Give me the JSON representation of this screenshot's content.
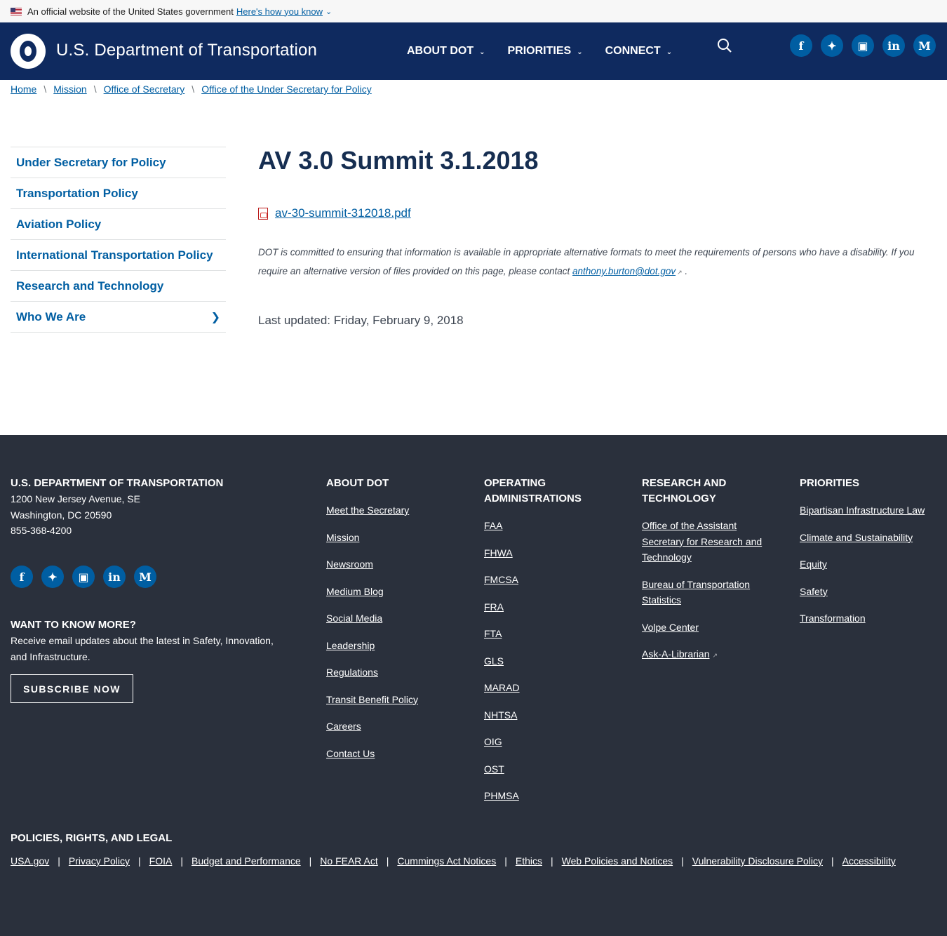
{
  "gov_banner": {
    "text": "An official website of the United States government",
    "how_link": "Here's how you know"
  },
  "header": {
    "site_title": "U.S. Department of Transportation",
    "nav": [
      {
        "label": "ABOUT DOT"
      },
      {
        "label": "PRIORITIES"
      },
      {
        "label": "CONNECT"
      }
    ],
    "social": [
      "facebook-icon",
      "twitter-icon",
      "instagram-icon",
      "linkedin-icon",
      "medium-icon"
    ]
  },
  "breadcrumb": [
    "Home",
    "Mission",
    "Office of Secretary",
    "Office of the Under Secretary for Policy"
  ],
  "sidenav": {
    "items": [
      {
        "label": "Under Secretary for Policy"
      },
      {
        "label": "Transportation Policy"
      },
      {
        "label": "Aviation Policy"
      },
      {
        "label": "International Transportation Policy"
      },
      {
        "label": "Research and Technology"
      },
      {
        "label": "Who We Are"
      }
    ]
  },
  "main": {
    "title": "AV 3.0 Summit 3.1.2018",
    "file_link": "av-30-summit-312018.pdf",
    "note_line1": "DOT is committed to ensuring that information is available in appropriate alternative formats to meet the requirements of persons who have a disability. If you require an alternative version of files provided on this page, please contact ",
    "note_email": "anthony.burton@dot.gov",
    "note_end": " .",
    "last_updated": "Last updated: Friday, February 9, 2018"
  },
  "footer": {
    "org": {
      "heading": "U.S. DEPARTMENT OF TRANSPORTATION",
      "address1": "1200 New Jersey Avenue, SE",
      "address2": "Washington, DC 20590",
      "phone": "855-368-4200"
    },
    "want_more": {
      "heading": "WANT TO KNOW MORE?",
      "text": "Receive email updates about the latest in Safety, Innovation, and Infrastructure.",
      "button": "SUBSCRIBE NOW"
    },
    "about": {
      "heading": "ABOUT DOT",
      "links": [
        "Meet the Secretary",
        "Mission",
        "Newsroom",
        "Medium Blog",
        "Social Media",
        "Leadership",
        "Regulations",
        "Transit Benefit Policy",
        "Careers",
        "Contact Us"
      ]
    },
    "operating": {
      "heading": "OPERATING ADMINISTRATIONS",
      "links": [
        "FAA",
        "FHWA",
        "FMCSA",
        "FRA",
        "FTA",
        "GLS",
        "MARAD",
        "NHTSA",
        "OIG",
        "OST",
        "PHMSA"
      ]
    },
    "research": {
      "heading": "RESEARCH AND TECHNOLOGY",
      "links": [
        "Office of the Assistant Secretary for Research and Technology",
        "Bureau of Transportation Statistics",
        "Volpe Center",
        "Ask-A-Librarian"
      ]
    },
    "priorities": {
      "heading": "PRIORITIES",
      "links": [
        "Bipartisan Infrastructure Law",
        "Climate and Sustainability",
        "Equity",
        "Safety",
        "Transformation"
      ]
    },
    "legal": {
      "heading": "POLICIES, RIGHTS, AND LEGAL",
      "links": [
        "USA.gov",
        "Privacy Policy",
        "FOIA",
        "Budget and Performance",
        "No FEAR Act",
        "Cummings Act Notices",
        "Ethics",
        "Web Policies and Notices",
        "Vulnerability Disclosure Policy",
        "Accessibility"
      ]
    }
  }
}
